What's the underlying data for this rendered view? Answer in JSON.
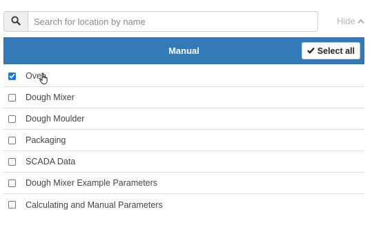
{
  "search": {
    "placeholder": "Search for location by name",
    "value": "",
    "icon": "search-icon"
  },
  "hide_toggle": {
    "label": "Hide",
    "icon": "chevron-up-icon"
  },
  "panel": {
    "title": "Manual",
    "select_all_label": "Select all",
    "select_all_icon": "checkmark-icon",
    "header_color": "#337ab7"
  },
  "items": [
    {
      "label": "Oven",
      "checked": true
    },
    {
      "label": "Dough Mixer",
      "checked": false
    },
    {
      "label": "Dough Moulder",
      "checked": false
    },
    {
      "label": "Packaging",
      "checked": false
    },
    {
      "label": "SCADA Data",
      "checked": false
    },
    {
      "label": "Dough Mixer Example Parameters",
      "checked": false
    },
    {
      "label": "Calculating and Manual Parameters",
      "checked": false
    }
  ]
}
